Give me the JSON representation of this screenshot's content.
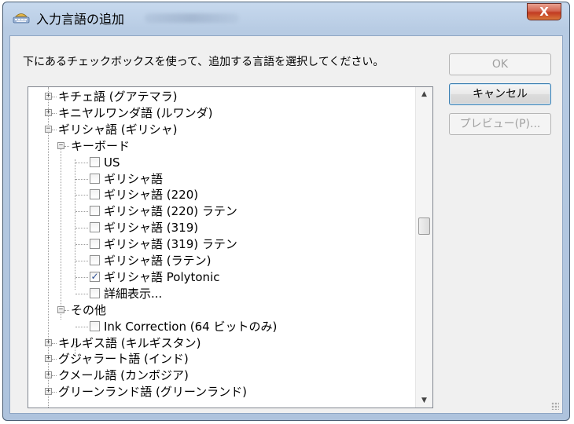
{
  "window": {
    "title": "入力言語の追加",
    "close_label": "X"
  },
  "instruction": "下にあるチェックボックスを使って、追加する言語を選択してください。",
  "buttons": {
    "ok": "OK",
    "cancel": "キャンセル",
    "preview": "プレビュー(P)..."
  },
  "tree": {
    "items": [
      {
        "label": "キチェ語 (グアテマラ)",
        "type": "language",
        "expanded": false
      },
      {
        "label": "キニヤルワンダ語 (ルワンダ)",
        "type": "language",
        "expanded": false
      },
      {
        "label": "ギリシャ語 (ギリシャ)",
        "type": "language",
        "expanded": true
      },
      {
        "label": "キーボード",
        "type": "group",
        "expanded": true
      },
      {
        "label": "US",
        "type": "checkbox",
        "checked": false
      },
      {
        "label": "ギリシャ語",
        "type": "checkbox",
        "checked": false
      },
      {
        "label": "ギリシャ語 (220)",
        "type": "checkbox",
        "checked": false
      },
      {
        "label": "ギリシャ語 (220) ラテン",
        "type": "checkbox",
        "checked": false
      },
      {
        "label": "ギリシャ語 (319)",
        "type": "checkbox",
        "checked": false
      },
      {
        "label": "ギリシャ語 (319) ラテン",
        "type": "checkbox",
        "checked": false
      },
      {
        "label": "ギリシャ語 (ラテン)",
        "type": "checkbox",
        "checked": false
      },
      {
        "label": "ギリシャ語 Polytonic",
        "type": "checkbox",
        "checked": true
      },
      {
        "label": "詳細表示...",
        "type": "checkbox",
        "checked": false
      },
      {
        "label": "その他",
        "type": "group",
        "expanded": true
      },
      {
        "label": "Ink Correction (64 ビットのみ)",
        "type": "checkbox",
        "checked": false
      },
      {
        "label": "キルギス語 (キルギスタン)",
        "type": "language",
        "expanded": false
      },
      {
        "label": "グジャラート語 (インド)",
        "type": "language",
        "expanded": false
      },
      {
        "label": "クメール語 (カンボジア)",
        "type": "language",
        "expanded": false
      },
      {
        "label": "グリーンランド語 (グリーンランド)",
        "type": "language",
        "expanded": false
      }
    ]
  },
  "scrollbar": {
    "up_icon": "arrow-up-icon",
    "down_icon": "arrow-down-icon"
  }
}
